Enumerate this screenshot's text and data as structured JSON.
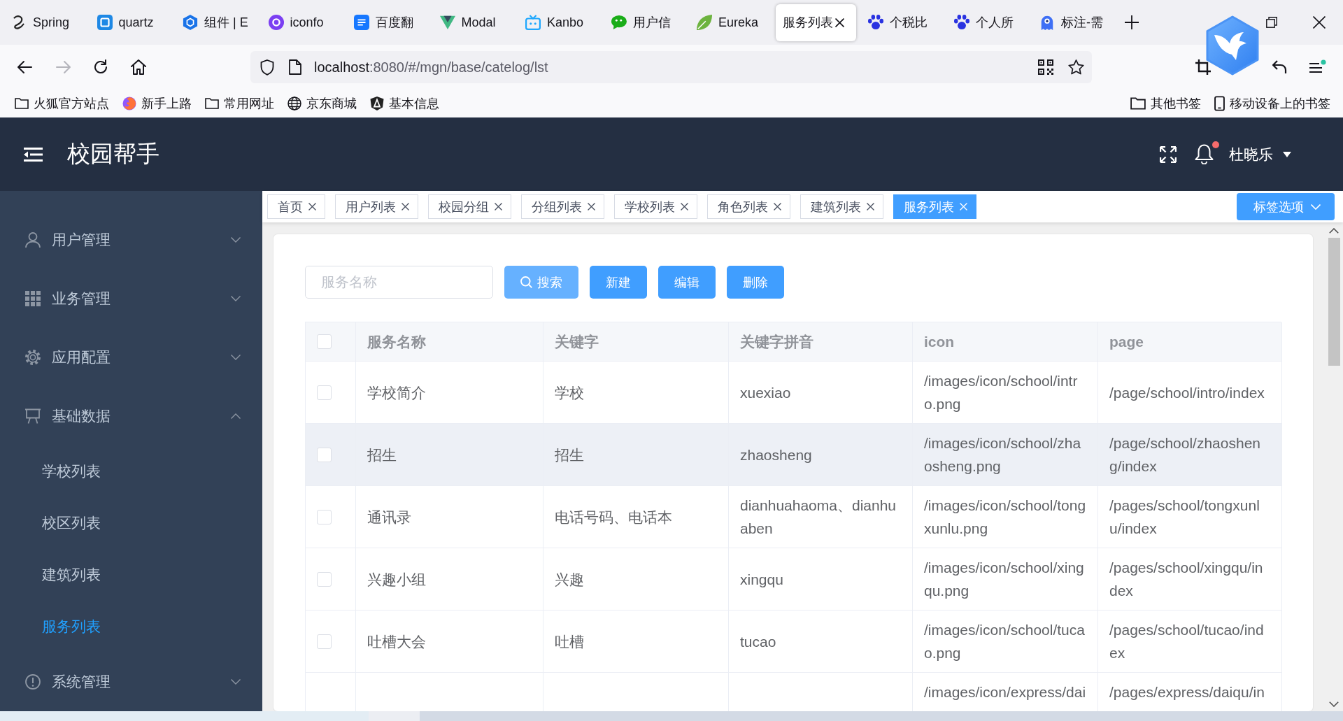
{
  "browser": {
    "tabs": [
      {
        "title": "Spring",
        "selected": false
      },
      {
        "title": "quartz",
        "selected": false
      },
      {
        "title": "组件 | E",
        "selected": false
      },
      {
        "title": "iconfo",
        "selected": false
      },
      {
        "title": "百度翻",
        "selected": false
      },
      {
        "title": "Modal",
        "selected": false
      },
      {
        "title": "Kanbo",
        "selected": false
      },
      {
        "title": "用户信",
        "selected": false
      },
      {
        "title": "Eureka",
        "selected": false
      },
      {
        "title": "服务列表",
        "selected": true
      },
      {
        "title": "个税比",
        "selected": false
      },
      {
        "title": "个人所",
        "selected": false
      },
      {
        "title": "标注-需",
        "selected": false
      }
    ],
    "nav_buttons": [
      {
        "disabled": false
      },
      {
        "disabled": true
      },
      {
        "disabled": false
      },
      {
        "disabled": false
      }
    ],
    "url": {
      "host": "localhost",
      "rest": ":8080/#/mgn/base/catelog/lst"
    },
    "bookmarks": [
      {
        "label": "火狐官方站点"
      },
      {
        "label": "新手上路"
      },
      {
        "label": "常用网址"
      },
      {
        "label": "京东商城"
      },
      {
        "label": "基本信息"
      }
    ],
    "other_bookmarks": [
      {
        "label": "其他书签"
      },
      {
        "label": "移动设备上的书签"
      }
    ]
  },
  "header": {
    "title": "校园帮手",
    "user": "杜晓乐",
    "unread": true
  },
  "sidebar": {
    "items": [
      {
        "label": "用户管理",
        "expanded": false
      },
      {
        "label": "业务管理",
        "expanded": false
      },
      {
        "label": "应用配置",
        "expanded": false
      },
      {
        "label": "基础数据",
        "expanded": true,
        "children": [
          {
            "label": "学校列表",
            "selected": false
          },
          {
            "label": "校区列表",
            "selected": false
          },
          {
            "label": "建筑列表",
            "selected": false
          },
          {
            "label": "服务列表",
            "selected": true
          }
        ]
      },
      {
        "label": "系统管理",
        "expanded": false
      }
    ]
  },
  "tags": {
    "items": [
      {
        "label": "首页",
        "selected": false
      },
      {
        "label": "用户列表",
        "selected": false
      },
      {
        "label": "校园分组",
        "selected": false
      },
      {
        "label": "分组列表",
        "selected": false
      },
      {
        "label": "学校列表",
        "selected": false
      },
      {
        "label": "角色列表",
        "selected": false
      },
      {
        "label": "建筑列表",
        "selected": false
      },
      {
        "label": "服务列表",
        "selected": true
      }
    ],
    "options_button": "标签选项"
  },
  "toolbar": {
    "search": {
      "placeholder": "服务名称"
    },
    "buttons": [
      {
        "label": "搜索",
        "hovered": true
      },
      {
        "label": "新建",
        "hovered": false
      },
      {
        "label": "编辑",
        "hovered": false
      },
      {
        "label": "删除",
        "hovered": false
      }
    ]
  },
  "table": {
    "all_checked": false,
    "columns": [
      "服务名称",
      "关键字",
      "关键字拼音",
      "icon",
      "page"
    ],
    "rows": [
      {
        "checked": false,
        "hovered": false,
        "service_name": "学校简介",
        "keyword": "学校",
        "keyword_pinyin": "xuexiao",
        "icon": "/images/icon/school/intro.png",
        "page": "/page/school/intro/index"
      },
      {
        "checked": false,
        "hovered": true,
        "service_name": "招生",
        "keyword": "招生",
        "keyword_pinyin": "zhaosheng",
        "icon": "/images/icon/school/zhaosheng.png",
        "page": "/page/school/zhaosheng/index"
      },
      {
        "checked": false,
        "hovered": false,
        "service_name": "通讯录",
        "keyword": "电话号码、电话本",
        "keyword_pinyin": "dianhuahaoma、dianhuaben",
        "icon": "/images/icon/school/tongxunlu.png",
        "page": "/pages/school/tongxunlu/index"
      },
      {
        "checked": false,
        "hovered": false,
        "service_name": "兴趣小组",
        "keyword": "兴趣",
        "keyword_pinyin": "xingqu",
        "icon": "/images/icon/school/xingqu.png",
        "page": "/pages/school/xingqu/index"
      },
      {
        "checked": false,
        "hovered": false,
        "service_name": "吐槽大会",
        "keyword": "吐槽",
        "keyword_pinyin": "tucao",
        "icon": "/images/icon/school/tucao.png",
        "page": "/pages/school/tucao/index"
      },
      {
        "icon": "/images/icon/express/dai",
        "page": "/pages/express/daiqu/in"
      }
    ]
  }
}
